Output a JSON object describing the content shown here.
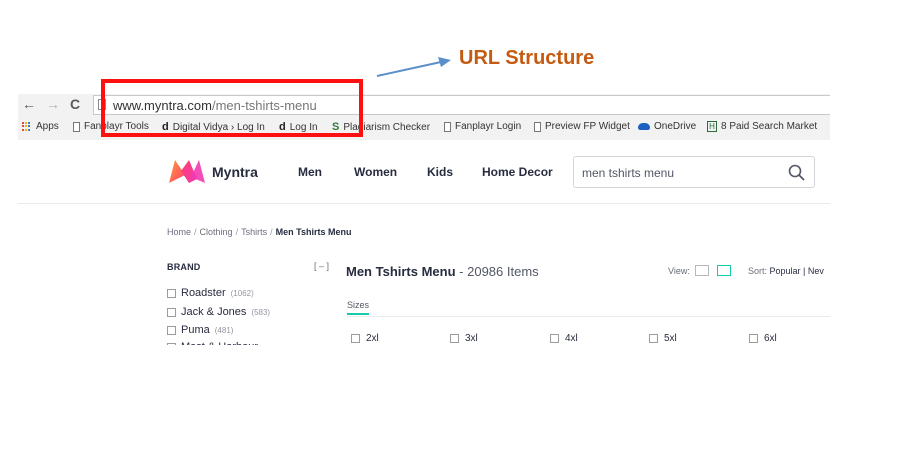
{
  "annotation": {
    "label": "URL Structure"
  },
  "browser": {
    "nav": {
      "back": "←",
      "forward": "→",
      "reload": "C"
    },
    "url": {
      "domain": "www.myntra.com",
      "path": "/men-tshirts-menu"
    },
    "bookmarks": [
      "Apps",
      "Fanplayr Tools",
      "Digital Vidya › Log In",
      "Log In",
      "Plagiarism Checker",
      "Fanplayr Login",
      "Preview FP Widget",
      "OneDrive",
      "8 Paid Search Market"
    ]
  },
  "site": {
    "brand": "Myntra",
    "nav": [
      "Men",
      "Women",
      "Kids",
      "Home Decor"
    ],
    "search": {
      "value": "men tshirts menu"
    }
  },
  "breadcrumb": {
    "items": [
      "Home",
      "Clothing",
      "Tshirts"
    ],
    "current": "Men Tshirts Menu",
    "separator": "/"
  },
  "filters": {
    "title": "BRAND",
    "collapse": "[ – ]",
    "brands": [
      {
        "name": "Roadster",
        "count": "(1062)"
      },
      {
        "name": "Jack & Jones",
        "count": "(583)"
      },
      {
        "name": "Puma",
        "count": "(481)"
      },
      {
        "name": "Mast & Harbour",
        "count": ""
      }
    ]
  },
  "results": {
    "title": "Men Tshirts Menu",
    "count": "- 20986 Items"
  },
  "view": {
    "label": "View:"
  },
  "sort": {
    "label": "Sort:",
    "value": "Popular | Nev"
  },
  "sizes": {
    "tab": "Sizes",
    "options": [
      "2xl",
      "3xl",
      "4xl",
      "5xl",
      "6xl"
    ]
  },
  "colors": {
    "accent": "#14cda8",
    "annotation": "#c55a11",
    "highlight": "#ff1010"
  }
}
